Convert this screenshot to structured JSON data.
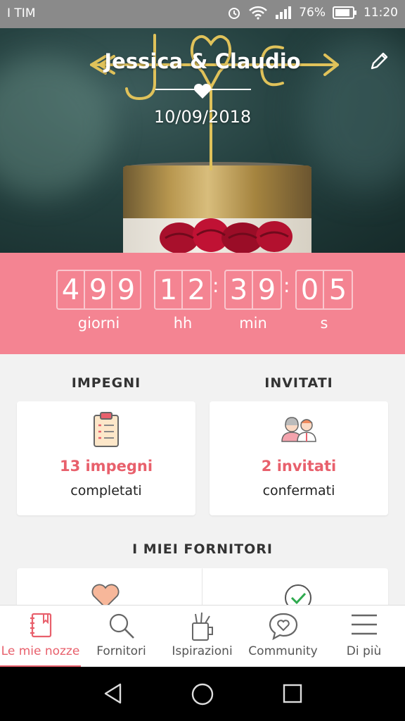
{
  "status_bar": {
    "carrier": "I TIM",
    "battery": "76%",
    "time": "11:20"
  },
  "hero": {
    "couple": "Jessica & Claudio",
    "date": "10/09/2018"
  },
  "countdown": {
    "days": [
      "4",
      "9",
      "9"
    ],
    "hours": [
      "1",
      "2"
    ],
    "minutes": [
      "3",
      "9"
    ],
    "seconds": [
      "0",
      "5"
    ],
    "labels": {
      "days": "giorni",
      "hours": "hh",
      "minutes": "min",
      "seconds": "s"
    }
  },
  "sections": {
    "tasks": {
      "title": "IMPEGNI",
      "count": "13 impegni",
      "sub": "completati"
    },
    "guests": {
      "title": "INVITATI",
      "count": "2 invitati",
      "sub": "confermati"
    },
    "vendors": {
      "title": "I MIEI FORNITORI"
    }
  },
  "nav": [
    {
      "label": "Le mie nozze",
      "icon": "notebook-icon",
      "active": true
    },
    {
      "label": "Fornitori",
      "icon": "search-icon"
    },
    {
      "label": "Ispirazioni",
      "icon": "inspiration-icon"
    },
    {
      "label": "Community",
      "icon": "chat-heart-icon"
    },
    {
      "label": "Di più",
      "icon": "menu-icon"
    }
  ],
  "colors": {
    "accent": "#e8606c",
    "countdown_bg": "#f48492",
    "content_bg": "#f2f2f2"
  }
}
